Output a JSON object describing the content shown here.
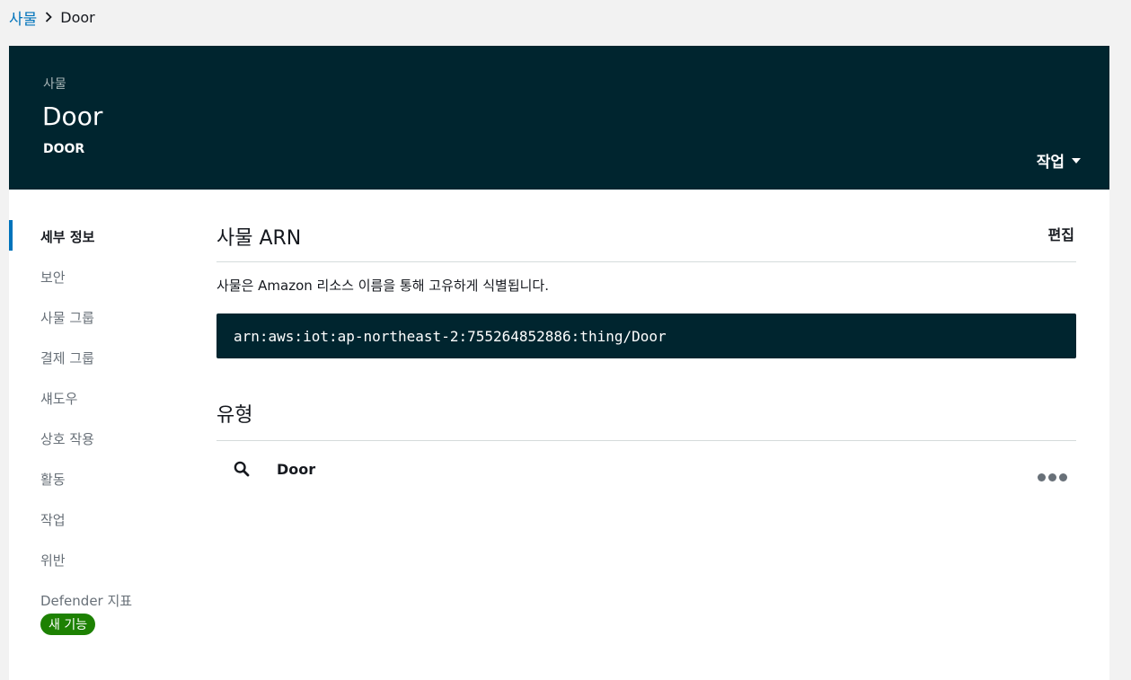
{
  "breadcrumb": {
    "parent": "사물",
    "current": "Door"
  },
  "header": {
    "kicker": "사물",
    "title": "Door",
    "subtitle": "DOOR",
    "actions_label": "작업"
  },
  "sidenav": {
    "items": [
      {
        "label": "세부 정보",
        "active": true
      },
      {
        "label": "보안"
      },
      {
        "label": "사물 그룹"
      },
      {
        "label": "결제 그룹"
      },
      {
        "label": "섀도우"
      },
      {
        "label": "상호 작용"
      },
      {
        "label": "활동"
      },
      {
        "label": "작업"
      },
      {
        "label": "위반"
      },
      {
        "label": "Defender 지표",
        "badge": "새 기능"
      }
    ]
  },
  "main": {
    "arn_section": {
      "title": "사물 ARN",
      "edit_label": "편집",
      "description": "사물은 Amazon 리소스 이름을 통해 고유하게 식별됩니다.",
      "arn": "arn:aws:iot:ap-northeast-2:755264852886:thing/Door"
    },
    "type_section": {
      "title": "유형",
      "type_name": "Door"
    }
  },
  "icons": {
    "breadcrumb_separator": "chevron-right-icon",
    "actions_caret": "caret-down-icon",
    "type_search": "search-icon",
    "type_more": "more-options-icon"
  },
  "colors": {
    "header_bg": "#00252f",
    "link": "#0073bb",
    "badge_bg": "#1d8102"
  }
}
